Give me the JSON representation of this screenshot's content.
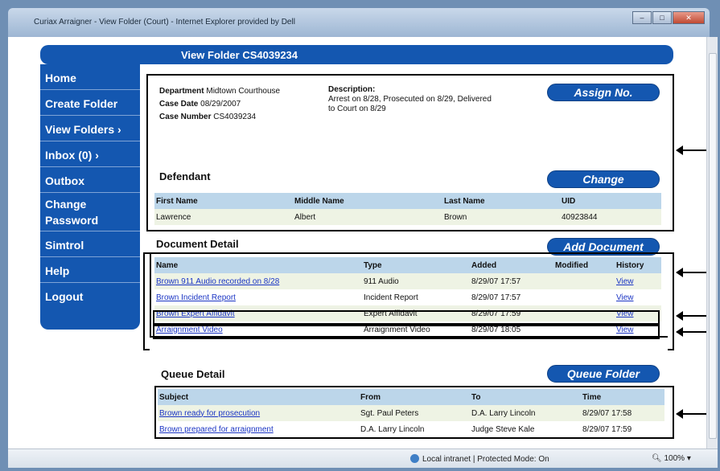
{
  "window": {
    "title": "Curiax Arraigner - View Folder (Court) - Internet Explorer provided by Dell"
  },
  "page": {
    "header_title": "View Folder CS4039234"
  },
  "sidebar": {
    "items": [
      {
        "label": "Home"
      },
      {
        "label": "Create Folder"
      },
      {
        "label": "View Folders ›"
      },
      {
        "label": "Inbox (0) ›"
      },
      {
        "label": "Outbox"
      },
      {
        "label": "Change"
      },
      {
        "label": "Password"
      },
      {
        "label": "Simtrol"
      },
      {
        "label": "Help"
      },
      {
        "label": "Logout"
      }
    ]
  },
  "folder": {
    "department_label": "Department",
    "department": "Midtown Courthouse",
    "case_date_label": "Case Date",
    "case_date": "08/29/2007",
    "case_number_label": "Case Number",
    "case_number": "CS4039234",
    "description_label": "Description:",
    "description_line1": "Arrest on 8/28, Prosecuted on 8/29, Delivered",
    "description_line2": "to Court on 8/29",
    "assign_button": "Assign No."
  },
  "defendant": {
    "title": "Defendant",
    "change_button": "Change",
    "columns": [
      "First Name",
      "Middle Name",
      "Last Name",
      "UID"
    ],
    "row": [
      "Lawrence",
      "Albert",
      "Brown",
      "40923844"
    ]
  },
  "documents": {
    "title": "Document Detail",
    "add_button": "Add Document",
    "columns": [
      "Name",
      "Type",
      "Added",
      "Modified",
      "History"
    ],
    "rows": [
      {
        "name": "Brown 911 Audio recorded on 8/28",
        "type": "911 Audio",
        "added": "8/29/07 17:57",
        "modified": "",
        "history": "View"
      },
      {
        "name": "Brown Incident Report",
        "type": "Incident Report",
        "added": "8/29/07 17:57",
        "modified": "",
        "history": "View"
      },
      {
        "name": "Brown Expert Affidavit",
        "type": "Expert Affidavit",
        "added": "8/29/07 17:59",
        "modified": "",
        "history": "View"
      },
      {
        "name": "Arraignment Video",
        "type": "Arraignment Video",
        "added": "8/29/07 18:05",
        "modified": "",
        "history": "View"
      }
    ]
  },
  "queue": {
    "title": "Queue Detail",
    "queue_button": "Queue Folder",
    "columns": [
      "Subject",
      "From",
      "To",
      "Time"
    ],
    "rows": [
      {
        "subject": "Brown ready for prosecution",
        "from": "Sgt. Paul Peters",
        "to": "D.A. Larry Lincoln",
        "time": "8/29/07 17:58"
      },
      {
        "subject": "Brown prepared for arraignment",
        "from": "D.A. Larry Lincoln",
        "to": "Judge Steve Kale",
        "time": "8/29/07 17:59"
      }
    ]
  },
  "statusbar": {
    "zone": "Local intranet | Protected Mode: On",
    "zoom": "100%"
  },
  "colors": {
    "brand_blue": "#1457b0",
    "table_header": "#bcd6ea",
    "alt_row": "#eef3e4",
    "link": "#1b35c4"
  }
}
